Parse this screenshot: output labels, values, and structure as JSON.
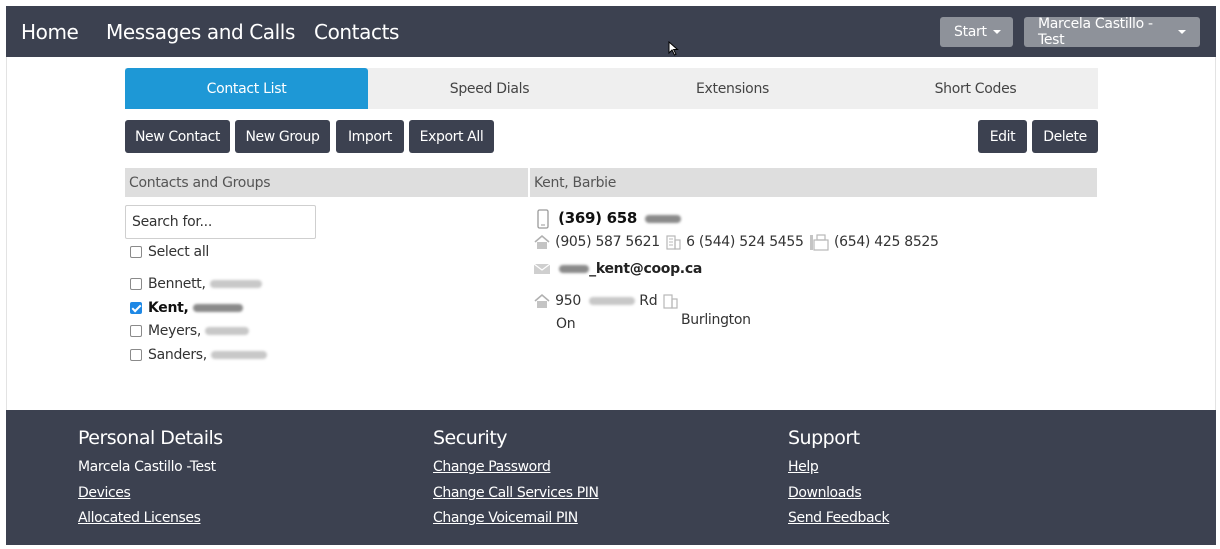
{
  "nav": {
    "home": "Home",
    "messages": "Messages and Calls",
    "contacts": "Contacts",
    "start": "Start",
    "user": "Marcela Castillo -Test"
  },
  "tabs": [
    "Contact List",
    "Speed Dials",
    "Extensions",
    "Short Codes"
  ],
  "actions": {
    "new_contact": "New Contact",
    "new_group": "New Group",
    "import": "Import",
    "export_all": "Export All",
    "edit": "Edit",
    "delete": "Delete"
  },
  "left_panel": {
    "header": "Contacts and Groups",
    "search_placeholder": "Search for...",
    "select_all": "Select all",
    "contacts": [
      {
        "name": "Bennett,",
        "checked": false
      },
      {
        "name": "Kent,",
        "checked": true
      },
      {
        "name": "Meyers,",
        "checked": false
      },
      {
        "name": "Sanders,",
        "checked": false
      }
    ]
  },
  "detail": {
    "header": "Kent, Barbie",
    "mobile": "(369) 658",
    "home_phone": "(905) 587 5621",
    "work_phone": "6 (544) 524 5455",
    "fax": "(654) 425 8525",
    "email_suffix": "_kent@coop.ca",
    "address_number": "950",
    "address_street": "Rd",
    "province": "On",
    "city": "Burlington"
  },
  "colors": {
    "nav_bg": "#3c4150",
    "accent": "#1e98d6",
    "button_bg": "#3c4150"
  },
  "footer": {
    "personal": {
      "title": "Personal Details",
      "name": "Marcela Castillo -Test",
      "devices": "Devices",
      "licenses": "Allocated Licenses"
    },
    "security": {
      "title": "Security",
      "change_password": "Change Password",
      "change_call_pin": "Change Call Services PIN",
      "change_voicemail_pin": "Change Voicemail PIN"
    },
    "support": {
      "title": "Support",
      "help": "Help",
      "downloads": "Downloads",
      "feedback": "Send Feedback"
    }
  }
}
